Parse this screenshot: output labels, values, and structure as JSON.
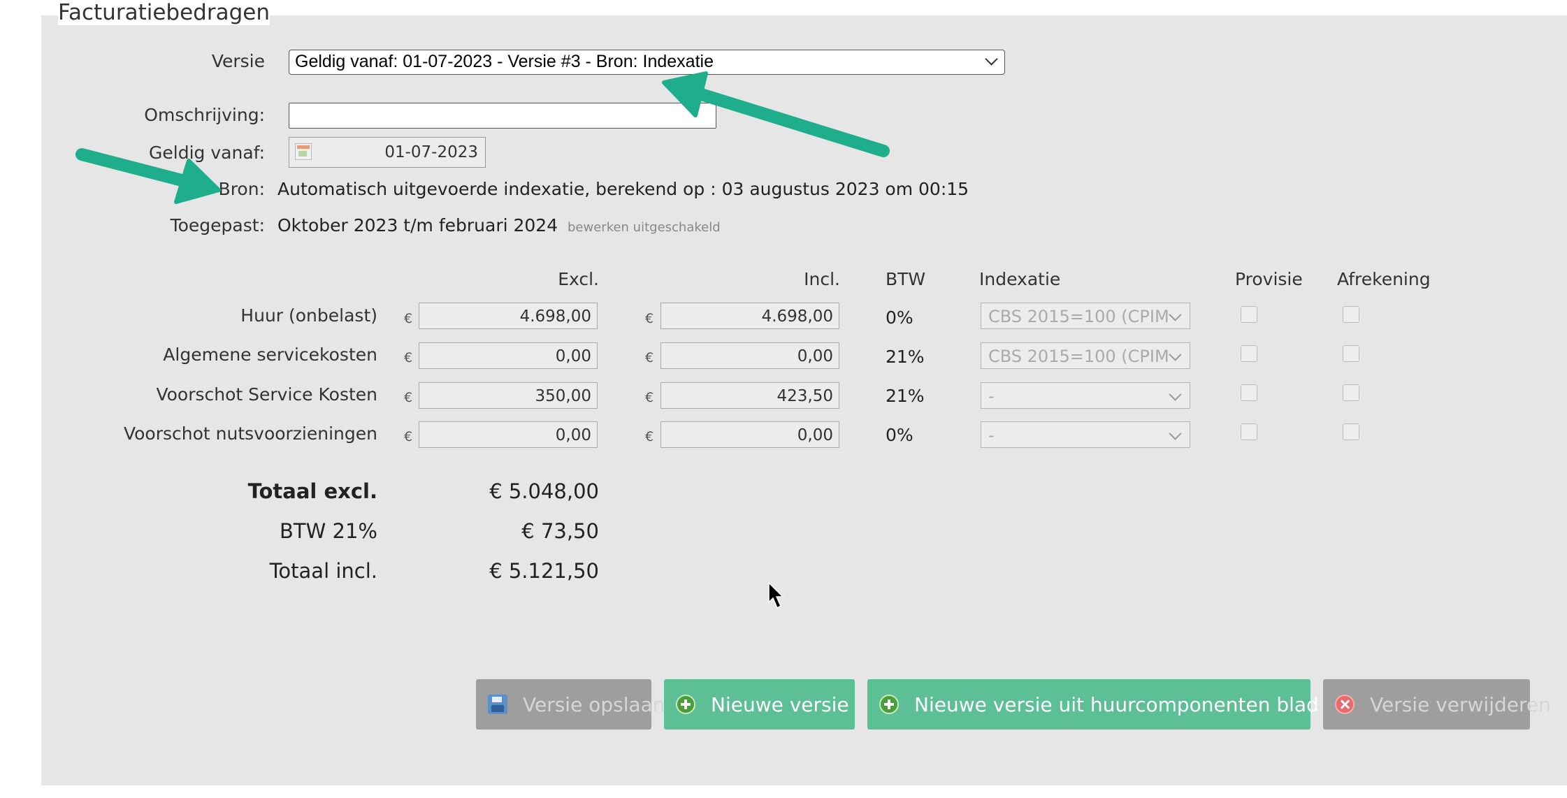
{
  "section": {
    "title": "Facturatiebedragen"
  },
  "form": {
    "versie_label": "Versie",
    "versie_value": "Geldig vanaf: 01-07-2023 - Versie #3 - Bron: Indexatie",
    "omschrijving_label": "Omschrijving:",
    "omschrijving_value": "",
    "geldig_label": "Geldig vanaf:",
    "geldig_value": "01-07-2023",
    "bron_label": "Bron:",
    "bron_value": "Automatisch uitgevoerde indexatie, berekend op : 03 augustus 2023 om 00:15",
    "toegepast_label": "Toegepast:",
    "toegepast_value": "Oktober 2023 t/m februari 2024",
    "toegepast_note": "bewerken uitgeschakeld"
  },
  "table": {
    "headers": {
      "excl": "Excl.",
      "incl": "Incl.",
      "btw": "BTW",
      "indexatie": "Indexatie",
      "provisie": "Provisie",
      "afrekening": "Afrekening"
    },
    "currency": "€",
    "rows": [
      {
        "label": "Huur (onbelast)",
        "excl": "4.698,00",
        "incl": "4.698,00",
        "btw": "0%",
        "indexatie": "CBS 2015=100 (CPIM",
        "provisie": false,
        "afrekening": false
      },
      {
        "label": "Algemene servicekosten",
        "excl": "0,00",
        "incl": "0,00",
        "btw": "21%",
        "indexatie": "CBS 2015=100 (CPIM",
        "provisie": false,
        "afrekening": false
      },
      {
        "label": "Voorschot Service Kosten",
        "excl": "350,00",
        "incl": "423,50",
        "btw": "21%",
        "indexatie": "-",
        "provisie": false,
        "afrekening": false
      },
      {
        "label": "Voorschot nutsvoorzieningen",
        "excl": "0,00",
        "incl": "0,00",
        "btw": "0%",
        "indexatie": "-",
        "provisie": false,
        "afrekening": false
      }
    ]
  },
  "totals": {
    "excl_label": "Totaal excl.",
    "excl_value": "€ 5.048,00",
    "btw_label": "BTW 21%",
    "btw_value": "€ 73,50",
    "incl_label": "Totaal incl.",
    "incl_value": "€ 5.121,50"
  },
  "buttons": {
    "save": "Versie opslaan",
    "new": "Nieuwe versie",
    "new_from_sheet": "Nieuwe versie uit huurcomponenten blad",
    "delete": "Versie verwijderen"
  },
  "colors": {
    "panel": "#e6e6e6",
    "green": "#5cbf95",
    "gray_button": "#9e9e9e",
    "arrow": "#1fae8c"
  },
  "icons": [
    "calendar-icon",
    "chevron-down-icon",
    "save-icon",
    "plus-circle-icon",
    "delete-circle-icon",
    "cursor-icon",
    "annotation-arrow"
  ]
}
